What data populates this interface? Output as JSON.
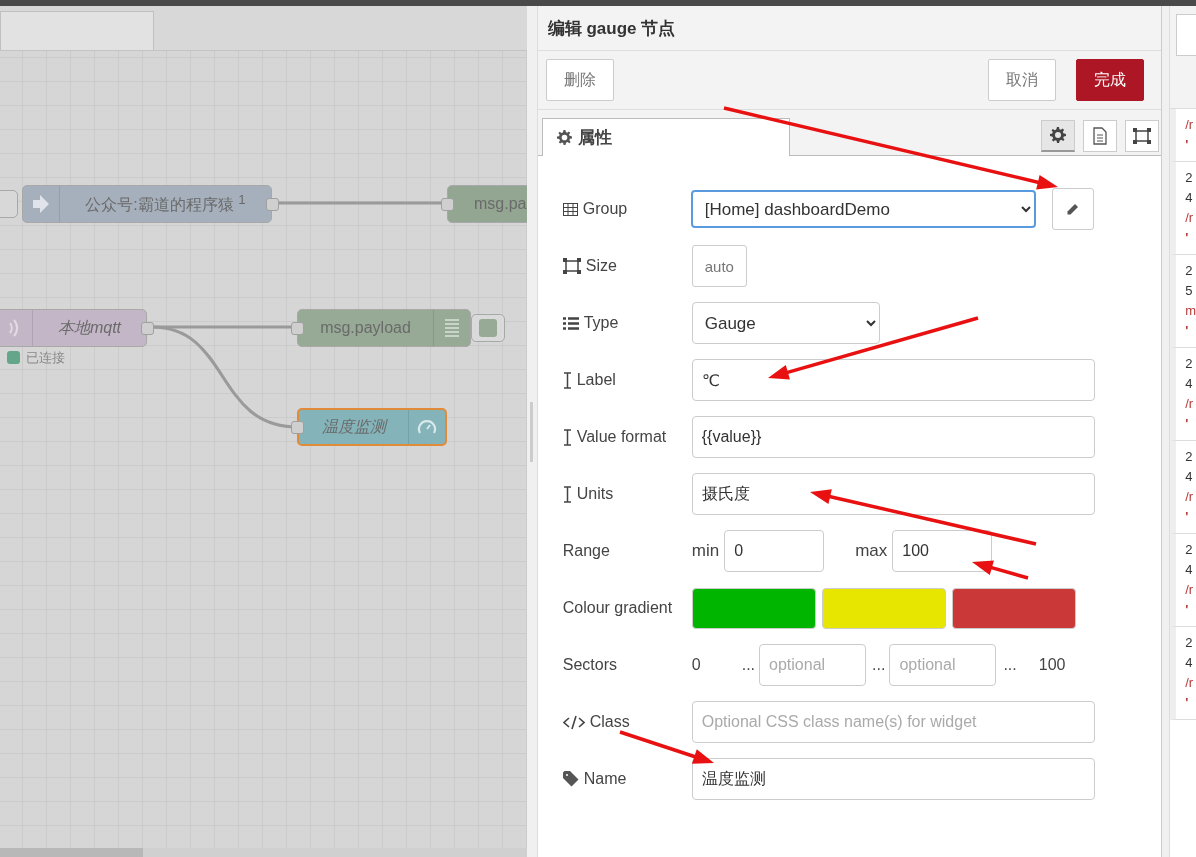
{
  "canvas": {
    "nodes": [
      {
        "kind": "inject",
        "label": "公众号:霸道的程序猿 $^{1}$"
      },
      {
        "kind": "debug_cut",
        "label": "msg.pa"
      },
      {
        "kind": "mqtt",
        "label": "本地mqtt",
        "status": "已连接"
      },
      {
        "kind": "debug",
        "label": "msg.payload"
      },
      {
        "kind": "gauge",
        "label": "温度监测",
        "selected": true
      }
    ]
  },
  "editor": {
    "title": "编辑 gauge 节点",
    "buttons": [
      {
        "kind": "delete",
        "label": "删除"
      },
      {
        "kind": "cancel",
        "label": "取消"
      },
      {
        "kind": "done",
        "label": "完成"
      }
    ],
    "tabs": [
      {
        "label": "属性",
        "selected": true
      }
    ],
    "tool_tabs": [
      {
        "kind": "settings",
        "selected": true
      },
      {
        "kind": "description",
        "selected": false
      },
      {
        "kind": "appearance",
        "selected": false
      }
    ],
    "fields": [
      {
        "kind": "select",
        "label": "Group",
        "value": "[Home] dashboardDemo",
        "focused": true
      },
      {
        "kind": "size",
        "label": "Size",
        "value": "auto"
      },
      {
        "kind": "select_short",
        "label": "Type",
        "value": "Gauge"
      },
      {
        "kind": "text",
        "label": "Label",
        "value": "℃"
      },
      {
        "kind": "text",
        "label": "Value format",
        "value": "{{value}}"
      },
      {
        "kind": "text",
        "label": "Units",
        "value": "摄氏度"
      },
      {
        "kind": "range",
        "label": "Range",
        "min_label": "min",
        "min": "0",
        "max_label": "max",
        "max": "100"
      },
      {
        "kind": "colours",
        "label": "Colour gradient",
        "colors": [
          {
            "color": "#00b500"
          },
          {
            "color": "#e6e600"
          },
          {
            "color": "#ca3838"
          }
        ]
      },
      {
        "kind": "sectors",
        "label": "Sectors",
        "start": "0",
        "sep1": "...",
        "placeholder1": "optional",
        "sep2": "...",
        "placeholder2": "optional",
        "sep3": "...",
        "end": "100"
      },
      {
        "kind": "text",
        "label": "Class",
        "placeholder": "Optional CSS class name(s) for widget"
      },
      {
        "kind": "text",
        "label": "Name",
        "value": "温度监测"
      }
    ]
  },
  "debug_sidebar": {
    "entries": [
      {
        "lines": [
          {
            "kind": "topic",
            "text": "/r"
          },
          {
            "kind": "value",
            "text": "'"
          }
        ]
      },
      {
        "lines": [
          {
            "kind": "meta",
            "text": "2"
          },
          {
            "kind": "meta",
            "text": "4"
          },
          {
            "kind": "topic",
            "text": "/r"
          },
          {
            "kind": "value",
            "text": "'"
          }
        ]
      },
      {
        "lines": [
          {
            "kind": "meta",
            "text": "2"
          },
          {
            "kind": "meta",
            "text": "5"
          },
          {
            "kind": "topic",
            "text": "m"
          },
          {
            "kind": "value",
            "text": "'"
          }
        ]
      },
      {
        "lines": [
          {
            "kind": "meta",
            "text": "2"
          },
          {
            "kind": "meta",
            "text": "4"
          },
          {
            "kind": "topic",
            "text": "/r"
          },
          {
            "kind": "value",
            "text": "'"
          }
        ]
      },
      {
        "lines": [
          {
            "kind": "meta",
            "text": "2"
          },
          {
            "kind": "meta",
            "text": "4"
          },
          {
            "kind": "topic",
            "text": "/r"
          },
          {
            "kind": "value",
            "text": "'"
          }
        ]
      },
      {
        "lines": [
          {
            "kind": "meta",
            "text": "2"
          },
          {
            "kind": "meta",
            "text": "4"
          },
          {
            "kind": "topic",
            "text": "/r"
          },
          {
            "kind": "value",
            "text": "'"
          }
        ]
      },
      {
        "lines": [
          {
            "kind": "meta",
            "text": "2"
          },
          {
            "kind": "meta",
            "text": "4"
          },
          {
            "kind": "topic",
            "text": "/r"
          },
          {
            "kind": "value",
            "text": "'"
          }
        ]
      }
    ]
  }
}
